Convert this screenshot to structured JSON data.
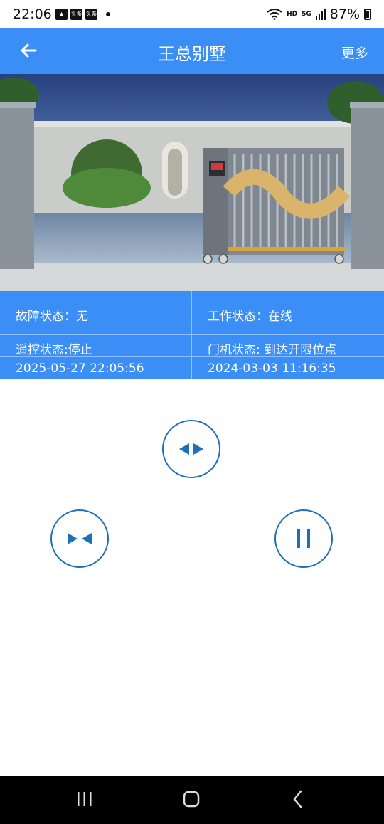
{
  "statusbar": {
    "time": "22:06",
    "notif1": "头条",
    "notif2": "头条",
    "network": "HD",
    "net_gen": "5G",
    "battery": "87%"
  },
  "appbar": {
    "title": "王总别墅",
    "more_label": "更多",
    "back_icon": "arrow-left-icon"
  },
  "status": {
    "fault": "故障状态：无",
    "work": "工作状态：在线",
    "remote": "遥控状态:停止",
    "door": "门机状态: 到达开限位点",
    "time_left": "2025-05-27 22:05:56",
    "time_right": "2024-03-03 11:16:35"
  },
  "controls": {
    "open_icon": "open-gate-icon",
    "close_icon": "close-gate-icon",
    "stop_icon": "pause-icon"
  },
  "colors": {
    "primary": "#3a8ef6",
    "control_stroke": "#1d6fb8"
  }
}
